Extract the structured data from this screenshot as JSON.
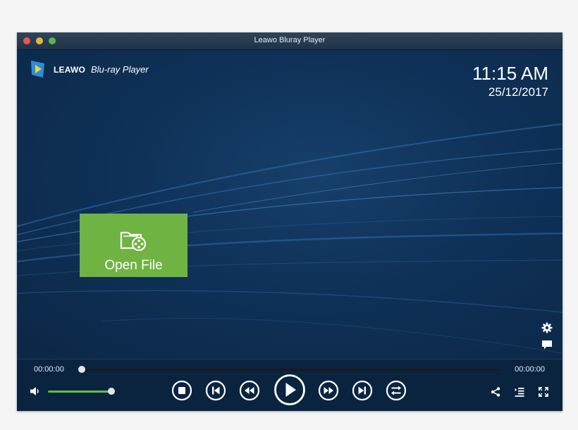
{
  "window": {
    "title": "Leawo Bluray Player"
  },
  "branding": {
    "brand": "LEAWO",
    "product": "Blu-ray Player"
  },
  "clock": {
    "time": "11:15 AM",
    "date": "25/12/2017"
  },
  "open_file": {
    "label": "Open File",
    "icon": "folder-film-icon"
  },
  "side_icons": [
    "gear-icon",
    "chat-bubble-icon"
  ],
  "player": {
    "elapsed": "00:00:00",
    "duration": "00:00:00",
    "progress": 0.0,
    "volume": 1.0
  },
  "controls": [
    "stop-icon",
    "previous-icon",
    "rewind-icon",
    "play-icon",
    "fast-forward-icon",
    "next-icon",
    "repeat-icon"
  ],
  "right_controls": [
    "share-icon",
    "playlist-icon",
    "fullscreen-icon"
  ],
  "colors": {
    "accent_green": "#6fb342",
    "volume_green": "#5fbf45",
    "background_navy": "#0f2d4c"
  }
}
